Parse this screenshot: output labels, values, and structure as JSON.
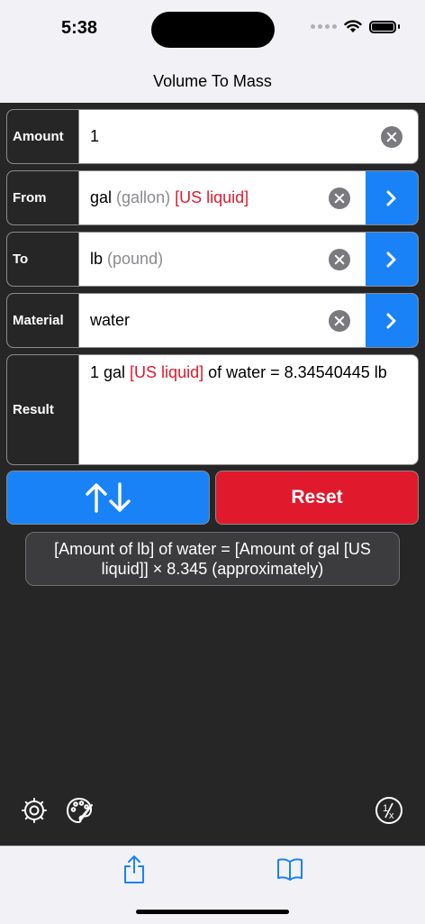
{
  "status_bar": {
    "time": "5:38"
  },
  "nav": {
    "title": "Volume To Mass"
  },
  "amount": {
    "label": "Amount",
    "value": "1"
  },
  "from": {
    "label": "From",
    "unit": "gal",
    "unit_name": "(gallon)",
    "qualifier": "[US liquid]"
  },
  "to": {
    "label": "To",
    "unit": "lb",
    "unit_name": "(pound)"
  },
  "material": {
    "label": "Material",
    "value": "water"
  },
  "result": {
    "label": "Result",
    "prefix": "1 gal ",
    "qualifier": "[US liquid]",
    "suffix": " of water = 8.34540445 lb"
  },
  "buttons": {
    "swap": "↑↓",
    "reset": "Reset"
  },
  "formula": "[Amount of lb] of water = [Amount of gal [US liquid]] × 8.345 (approximately)",
  "icons": {
    "settings": "gear-icon",
    "theme": "palette-icon",
    "reciprocal": "one-over-x-icon",
    "share": "share-icon",
    "book": "book-icon"
  },
  "colors": {
    "accent_blue": "#1a82f7",
    "reset_red": "#e0192d",
    "qualifier_red": "#e0192d",
    "background": "#262626"
  }
}
